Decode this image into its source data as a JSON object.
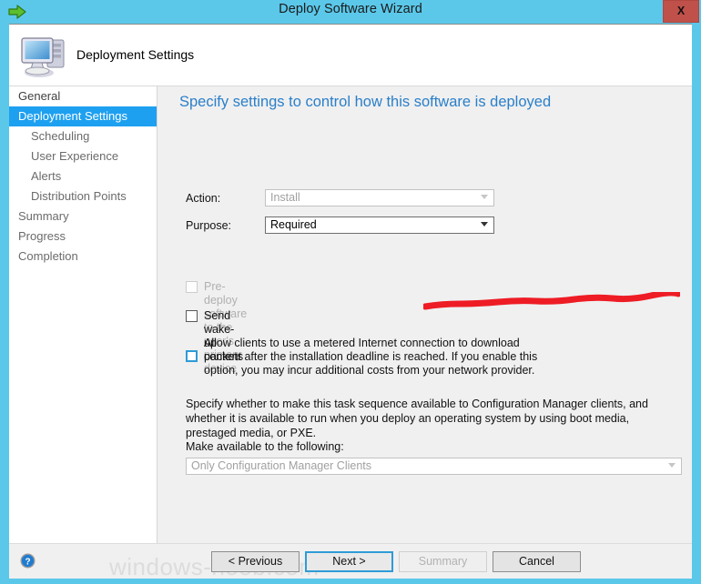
{
  "window": {
    "title": "Deploy Software Wizard",
    "back_icon": "back-arrow-icon",
    "close_label": "X",
    "accent_color": "#5BC8EA",
    "close_color": "#c0504a"
  },
  "wizard_header": {
    "icon": "computer-icon",
    "title": "Deployment Settings"
  },
  "sidebar": {
    "items": [
      {
        "label": "General",
        "level": 0,
        "active": false
      },
      {
        "label": "Deployment Settings",
        "level": 0,
        "active": true
      },
      {
        "label": "Scheduling",
        "level": 1,
        "active": false
      },
      {
        "label": "User Experience",
        "level": 1,
        "active": false
      },
      {
        "label": "Alerts",
        "level": 1,
        "active": false
      },
      {
        "label": "Distribution Points",
        "level": 1,
        "active": false
      },
      {
        "label": "Summary",
        "level": 0,
        "active": false
      },
      {
        "label": "Progress",
        "level": 0,
        "active": false
      },
      {
        "label": "Completion",
        "level": 0,
        "active": false
      }
    ],
    "highlight_color": "#1ea0f0"
  },
  "content": {
    "heading": "Specify settings to control how this software is deployed",
    "heading_color": "#2a7fc9",
    "action": {
      "label": "Action:",
      "value": "Install",
      "disabled": true
    },
    "purpose": {
      "label": "Purpose:",
      "value": "Required",
      "disabled": false
    },
    "annotation": {
      "name": "red-underline-annotation",
      "color": "#ee1c25"
    },
    "checkboxes": [
      {
        "label": "Pre-deploy software to the user's primary device",
        "checked": false,
        "disabled": true,
        "focused": false
      },
      {
        "label": "Send wake-up packets",
        "checked": false,
        "disabled": false,
        "focused": false
      },
      {
        "label": "Allow clients to use a metered Internet connection to download content after the installation deadline is reached. If you enable this option, you may incur additional costs from your network provider.",
        "checked": false,
        "disabled": false,
        "focused": true
      }
    ],
    "description": "Specify whether to make this task sequence available to Configuration Manager clients, and whether it is available to run when you deploy an operating system by using boot media, prestaged media, or PXE.",
    "make_available": {
      "label": "Make available to the following:",
      "value": "Only Configuration Manager Clients",
      "disabled": true
    }
  },
  "footer": {
    "help_icon": "help-icon",
    "watermark": "windows-noob.com",
    "buttons": [
      {
        "label": "< Previous",
        "state": "normal"
      },
      {
        "label": "Next >",
        "state": "focused"
      },
      {
        "label": "Summary",
        "state": "disabled"
      },
      {
        "label": "Cancel",
        "state": "normal"
      }
    ]
  }
}
